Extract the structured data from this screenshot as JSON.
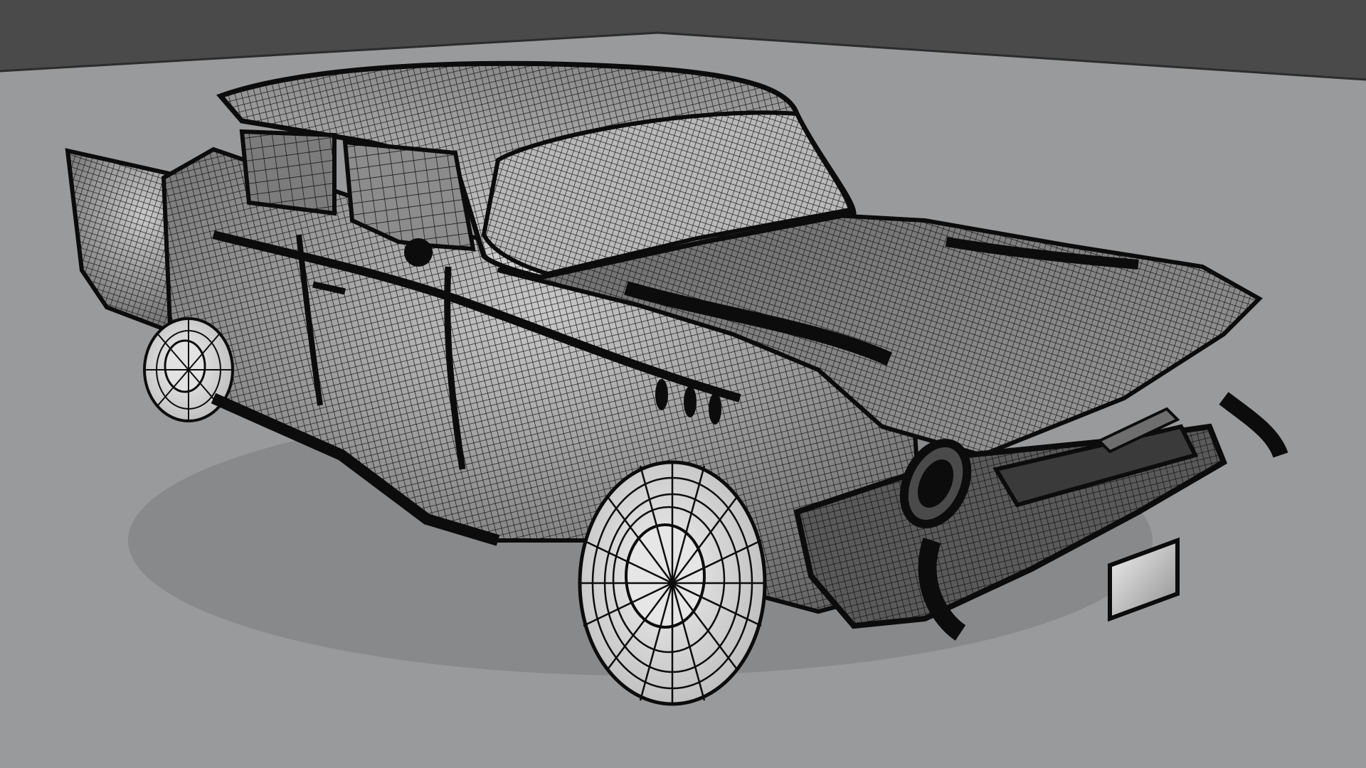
{
  "scene": {
    "subject": "car-wireframe-render",
    "colors": {
      "backdrop": "#4a4a4a",
      "floor": "#999a9b",
      "mesh_line": "#0c0c0c",
      "surface_light": "#d9d9d9",
      "surface_mid": "#8f8f8f",
      "surface_dark": "#3a3a3a",
      "plate": "#c4c4c4"
    }
  }
}
